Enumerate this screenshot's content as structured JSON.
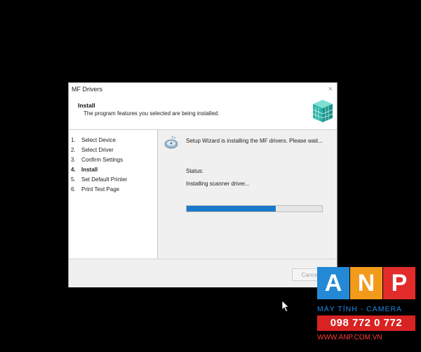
{
  "window": {
    "title": "MF Drivers",
    "close_glyph": "×"
  },
  "header": {
    "title": "Install",
    "subtitle": "The program features you selected are being installed.",
    "icon": "printer-cube-icon"
  },
  "steps": [
    {
      "num": "1.",
      "label": "Select Device",
      "current": false
    },
    {
      "num": "2.",
      "label": "Select Driver",
      "current": false
    },
    {
      "num": "3.",
      "label": "Confirm Settings",
      "current": false
    },
    {
      "num": "4.",
      "label": "Install",
      "current": true
    },
    {
      "num": "5.",
      "label": "Set Default Printer",
      "current": false
    },
    {
      "num": "6.",
      "label": "Print Test Page",
      "current": false
    }
  ],
  "main": {
    "icon": "setup-wizard-icon",
    "message": "Setup Wizard is installing the MF drivers. Please wait...",
    "status_label": "Status:",
    "status_text": "Installing scanner driver...",
    "progress_fraction": 0.66
  },
  "footer": {
    "cancel_label": "Cancel"
  },
  "watermark": {
    "letters": [
      "A",
      "N",
      "P"
    ],
    "tagline": "MÁY TÍNH - CAMERA",
    "phone": "098 772 0 772",
    "website": "WWW.ANP.COM.VN"
  },
  "colors": {
    "progress": "#1979ca",
    "accent_blue": "#2389d6",
    "accent_orange": "#f29a1a",
    "accent_red": "#e22b2b"
  }
}
